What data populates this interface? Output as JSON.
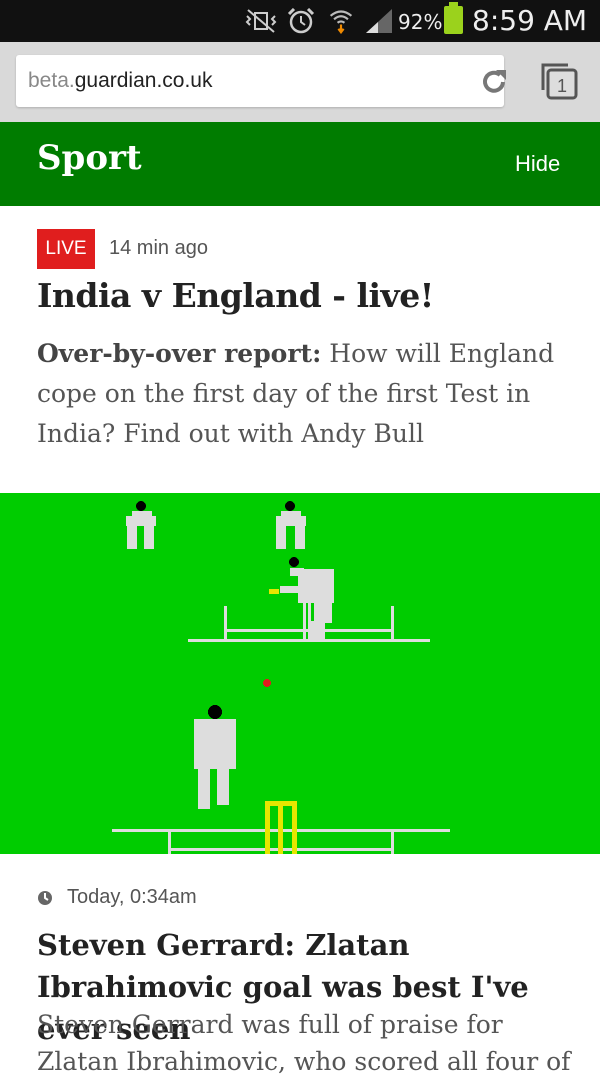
{
  "status_bar": {
    "battery_percent": "92%",
    "time": "8:59 AM",
    "icons": [
      "mute-vibrate-icon",
      "alarm-icon",
      "wifi-icon",
      "signal-icon",
      "battery-icon"
    ]
  },
  "browser": {
    "url_subdomain": "beta.",
    "url_domain": "guardian.co.uk",
    "tab_count": "1",
    "icons": [
      "reload-icon",
      "tabs-icon"
    ]
  },
  "section": {
    "title": "Sport",
    "hide_label": "Hide",
    "color": "#007c00"
  },
  "articles": [
    {
      "badge": "LIVE",
      "time": "14 min ago",
      "headline": "India v England - live!",
      "kicker": "Over-by-over report:",
      "standfirst": "How will England cope on the first day of the first Test in India? Find out with Andy Bull"
    },
    {
      "time": "Today, 0:34am",
      "headline": "Steven Gerrard: Zlatan Ibrahimovic goal was best I've ever seen",
      "standfirst": "Steven Gerrard was full of praise for Zlatan Ibrahimovic, who scored all four of"
    }
  ],
  "colors": {
    "live_badge": "#e01e1e",
    "pitch": "#00cc00"
  }
}
